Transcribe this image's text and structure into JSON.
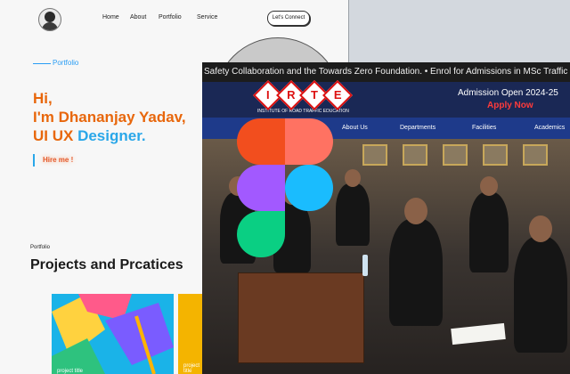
{
  "portfolio": {
    "nav": [
      "Home",
      "About",
      "Portfolio",
      "Service"
    ],
    "connect_label": "Let's Connect",
    "section_tag": "Portfolio",
    "hero_line1": "Hi,",
    "hero_line2": "I'm Dhananjay Yadav,",
    "hero_line3a": "UI UX ",
    "hero_line3b": "Designer.",
    "hire_label": "Hire me !",
    "projects_tag": "Portfolio",
    "projects_title": "Projects and Prcatices",
    "card1_caption": "project title",
    "card2_caption": "project title"
  },
  "irte": {
    "ticker": "Safety Collaboration and the Towards Zero Foundation. • Enrol for Admissions in MSc Traffic",
    "logo_letters": [
      "I",
      "R",
      "T",
      "E"
    ],
    "logo_subtitle": "INSTITUTE OF ROAD TRAFFIC EDUCATION",
    "admission": "Admission Open 2024-25",
    "apply": "Apply Now",
    "menu": [
      "About Us",
      "Departments",
      "Facilities",
      "Academics"
    ]
  },
  "colors": {
    "accent_blue": "#2aa7e9",
    "accent_orange": "#e8670c",
    "irte_navy": "#1a2855",
    "apply_red": "#ff3b3b"
  }
}
